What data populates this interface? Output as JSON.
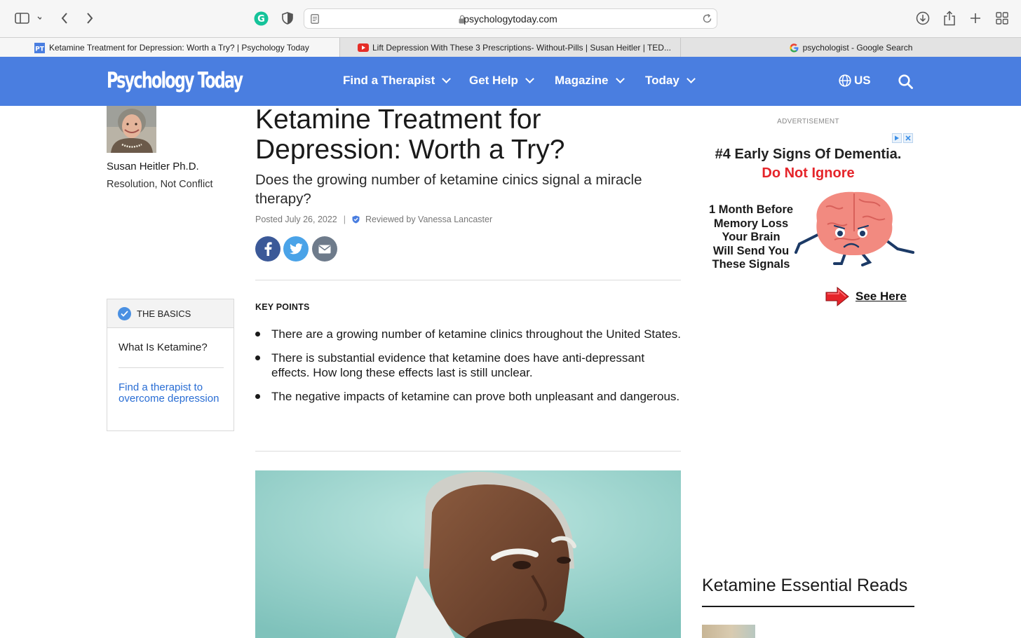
{
  "browser": {
    "url": "psychologytoday.com",
    "tabs": [
      {
        "favicon": "pt-favicon-icon",
        "label": "Ketamine Treatment for Depression: Worth a Try? | Psychology Today",
        "active": true
      },
      {
        "favicon": "youtube-favicon-icon",
        "label": "Lift Depression With These 3 Prescriptions- Without-Pills | Susan Heitler | TED...",
        "active": false
      },
      {
        "favicon": "google-favicon-icon",
        "label": "psychologist - Google Search",
        "active": false
      }
    ]
  },
  "site": {
    "logo": "Psychology Today",
    "nav": [
      {
        "label": "Find a Therapist"
      },
      {
        "label": "Get Help"
      },
      {
        "label": "Magazine"
      },
      {
        "label": "Today"
      }
    ],
    "region": "US",
    "brand_color": "#4a7ee0"
  },
  "author": {
    "name": "Susan Heitler Ph.D.",
    "blog": "Resolution, Not Conflict"
  },
  "basics": {
    "heading": "THE BASICS",
    "item": "What Is Ketamine?",
    "link": "Find a therapist to overcome depression"
  },
  "article": {
    "title": "Ketamine Treatment for Depression: Worth a Try?",
    "subtitle": "Does the growing number of ketamine cinics signal a miracle therapy?",
    "posted": "Posted July 26, 2022",
    "reviewed": "Reviewed by Vanessa Lancaster",
    "key_points_heading": "KEY POINTS",
    "key_points": [
      "There are a growing number of ketamine clinics throughout the United States.",
      "There is substantial evidence that ketamine does have anti-depressant effects. How long these effects last is still unclear.",
      "The negative impacts of ketamine can prove both unpleasant and dangerous."
    ]
  },
  "ad": {
    "label": "ADVERTISEMENT",
    "headline": "#4 Early Signs Of Dementia.",
    "headline_red": "Do Not Ignore",
    "body_lines": [
      "1 Month Before",
      "Memory Loss",
      "Your Brain",
      "Will Send You",
      "These Signals"
    ],
    "cta": "See Here"
  },
  "sidebar": {
    "essential_reads_title": "Ketamine Essential Reads"
  }
}
